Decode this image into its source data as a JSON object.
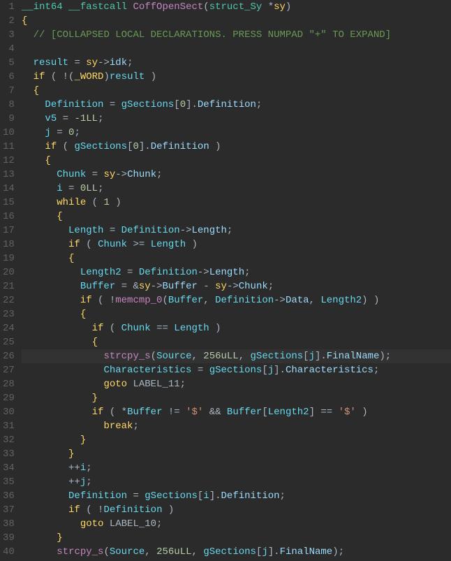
{
  "highlighted_line": 26,
  "lines": [
    {
      "n": 1,
      "tokens": [
        {
          "t": "__int64 __fastcall ",
          "c": "tok-type"
        },
        {
          "t": "CoffOpenSect",
          "c": "tok-func"
        },
        {
          "t": "(",
          "c": "tok-paren"
        },
        {
          "t": "struct_Sy ",
          "c": "tok-type"
        },
        {
          "t": "*",
          "c": "tok-op"
        },
        {
          "t": "sy",
          "c": "tok-id"
        },
        {
          "t": ")",
          "c": "tok-paren"
        }
      ]
    },
    {
      "n": 2,
      "tokens": [
        {
          "t": "{",
          "c": "tok-brace"
        }
      ]
    },
    {
      "n": 3,
      "tokens": [
        {
          "t": "  ",
          "c": ""
        },
        {
          "t": "// [COLLAPSED LOCAL DECLARATIONS. PRESS NUMPAD \"+\" TO EXPAND]",
          "c": "tok-comment"
        }
      ]
    },
    {
      "n": 4,
      "tokens": []
    },
    {
      "n": 5,
      "tokens": [
        {
          "t": "  ",
          "c": ""
        },
        {
          "t": "result",
          "c": "tok-local"
        },
        {
          "t": " = ",
          "c": "tok-op"
        },
        {
          "t": "sy",
          "c": "tok-id"
        },
        {
          "t": "->",
          "c": "tok-op"
        },
        {
          "t": "idk",
          "c": "tok-member"
        },
        {
          "t": ";",
          "c": "tok-punc"
        }
      ]
    },
    {
      "n": 6,
      "tokens": [
        {
          "t": "  ",
          "c": ""
        },
        {
          "t": "if",
          "c": "tok-kw"
        },
        {
          "t": " ( !(",
          "c": "tok-paren"
        },
        {
          "t": "_WORD",
          "c": "tok-cast"
        },
        {
          "t": ")",
          "c": "tok-paren"
        },
        {
          "t": "result",
          "c": "tok-local"
        },
        {
          "t": " )",
          "c": "tok-paren"
        }
      ]
    },
    {
      "n": 7,
      "tokens": [
        {
          "t": "  ",
          "c": ""
        },
        {
          "t": "{",
          "c": "tok-brace"
        }
      ]
    },
    {
      "n": 8,
      "tokens": [
        {
          "t": "    ",
          "c": ""
        },
        {
          "t": "Definition",
          "c": "tok-local"
        },
        {
          "t": " = ",
          "c": "tok-op"
        },
        {
          "t": "gSections",
          "c": "tok-global"
        },
        {
          "t": "[",
          "c": "tok-paren"
        },
        {
          "t": "0",
          "c": "tok-num"
        },
        {
          "t": "].",
          "c": "tok-punc"
        },
        {
          "t": "Definition",
          "c": "tok-member"
        },
        {
          "t": ";",
          "c": "tok-punc"
        }
      ]
    },
    {
      "n": 9,
      "tokens": [
        {
          "t": "    ",
          "c": ""
        },
        {
          "t": "v5",
          "c": "tok-local"
        },
        {
          "t": " = ",
          "c": "tok-op"
        },
        {
          "t": "-1LL",
          "c": "tok-num"
        },
        {
          "t": ";",
          "c": "tok-punc"
        }
      ]
    },
    {
      "n": 10,
      "tokens": [
        {
          "t": "    ",
          "c": ""
        },
        {
          "t": "j",
          "c": "tok-local"
        },
        {
          "t": " = ",
          "c": "tok-op"
        },
        {
          "t": "0",
          "c": "tok-num"
        },
        {
          "t": ";",
          "c": "tok-punc"
        }
      ]
    },
    {
      "n": 11,
      "tokens": [
        {
          "t": "    ",
          "c": ""
        },
        {
          "t": "if",
          "c": "tok-kw"
        },
        {
          "t": " ( ",
          "c": "tok-paren"
        },
        {
          "t": "gSections",
          "c": "tok-global"
        },
        {
          "t": "[",
          "c": "tok-paren"
        },
        {
          "t": "0",
          "c": "tok-num"
        },
        {
          "t": "].",
          "c": "tok-punc"
        },
        {
          "t": "Definition",
          "c": "tok-member"
        },
        {
          "t": " )",
          "c": "tok-paren"
        }
      ]
    },
    {
      "n": 12,
      "tokens": [
        {
          "t": "    ",
          "c": ""
        },
        {
          "t": "{",
          "c": "tok-brace"
        }
      ]
    },
    {
      "n": 13,
      "tokens": [
        {
          "t": "      ",
          "c": ""
        },
        {
          "t": "Chunk",
          "c": "tok-local"
        },
        {
          "t": " = ",
          "c": "tok-op"
        },
        {
          "t": "sy",
          "c": "tok-id"
        },
        {
          "t": "->",
          "c": "tok-op"
        },
        {
          "t": "Chunk",
          "c": "tok-member"
        },
        {
          "t": ";",
          "c": "tok-punc"
        }
      ]
    },
    {
      "n": 14,
      "tokens": [
        {
          "t": "      ",
          "c": ""
        },
        {
          "t": "i",
          "c": "tok-local"
        },
        {
          "t": " = ",
          "c": "tok-op"
        },
        {
          "t": "0LL",
          "c": "tok-num"
        },
        {
          "t": ";",
          "c": "tok-punc"
        }
      ]
    },
    {
      "n": 15,
      "tokens": [
        {
          "t": "      ",
          "c": ""
        },
        {
          "t": "while",
          "c": "tok-kw"
        },
        {
          "t": " ( ",
          "c": "tok-paren"
        },
        {
          "t": "1",
          "c": "tok-num"
        },
        {
          "t": " )",
          "c": "tok-paren"
        }
      ]
    },
    {
      "n": 16,
      "tokens": [
        {
          "t": "      ",
          "c": ""
        },
        {
          "t": "{",
          "c": "tok-brace"
        }
      ]
    },
    {
      "n": 17,
      "tokens": [
        {
          "t": "        ",
          "c": ""
        },
        {
          "t": "Length",
          "c": "tok-local"
        },
        {
          "t": " = ",
          "c": "tok-op"
        },
        {
          "t": "Definition",
          "c": "tok-local"
        },
        {
          "t": "->",
          "c": "tok-op"
        },
        {
          "t": "Length",
          "c": "tok-member"
        },
        {
          "t": ";",
          "c": "tok-punc"
        }
      ]
    },
    {
      "n": 18,
      "tokens": [
        {
          "t": "        ",
          "c": ""
        },
        {
          "t": "if",
          "c": "tok-kw"
        },
        {
          "t": " ( ",
          "c": "tok-paren"
        },
        {
          "t": "Chunk",
          "c": "tok-local"
        },
        {
          "t": " >= ",
          "c": "tok-op"
        },
        {
          "t": "Length",
          "c": "tok-local"
        },
        {
          "t": " )",
          "c": "tok-paren"
        }
      ]
    },
    {
      "n": 19,
      "tokens": [
        {
          "t": "        ",
          "c": ""
        },
        {
          "t": "{",
          "c": "tok-brace"
        }
      ]
    },
    {
      "n": 20,
      "tokens": [
        {
          "t": "          ",
          "c": ""
        },
        {
          "t": "Length2",
          "c": "tok-local"
        },
        {
          "t": " = ",
          "c": "tok-op"
        },
        {
          "t": "Definition",
          "c": "tok-local"
        },
        {
          "t": "->",
          "c": "tok-op"
        },
        {
          "t": "Length",
          "c": "tok-member"
        },
        {
          "t": ";",
          "c": "tok-punc"
        }
      ]
    },
    {
      "n": 21,
      "tokens": [
        {
          "t": "          ",
          "c": ""
        },
        {
          "t": "Buffer",
          "c": "tok-local"
        },
        {
          "t": " = &",
          "c": "tok-op"
        },
        {
          "t": "sy",
          "c": "tok-id"
        },
        {
          "t": "->",
          "c": "tok-op"
        },
        {
          "t": "Buffer",
          "c": "tok-member"
        },
        {
          "t": " - ",
          "c": "tok-op"
        },
        {
          "t": "sy",
          "c": "tok-id"
        },
        {
          "t": "->",
          "c": "tok-op"
        },
        {
          "t": "Chunk",
          "c": "tok-member"
        },
        {
          "t": ";",
          "c": "tok-punc"
        }
      ]
    },
    {
      "n": 22,
      "tokens": [
        {
          "t": "          ",
          "c": ""
        },
        {
          "t": "if",
          "c": "tok-kw"
        },
        {
          "t": " ( !",
          "c": "tok-paren"
        },
        {
          "t": "memcmp_0",
          "c": "tok-func"
        },
        {
          "t": "(",
          "c": "tok-paren"
        },
        {
          "t": "Buffer",
          "c": "tok-local"
        },
        {
          "t": ", ",
          "c": "tok-punc"
        },
        {
          "t": "Definition",
          "c": "tok-local"
        },
        {
          "t": "->",
          "c": "tok-op"
        },
        {
          "t": "Data",
          "c": "tok-member"
        },
        {
          "t": ", ",
          "c": "tok-punc"
        },
        {
          "t": "Length2",
          "c": "tok-local"
        },
        {
          "t": ") )",
          "c": "tok-paren"
        }
      ]
    },
    {
      "n": 23,
      "tokens": [
        {
          "t": "          ",
          "c": ""
        },
        {
          "t": "{",
          "c": "tok-brace"
        }
      ]
    },
    {
      "n": 24,
      "tokens": [
        {
          "t": "            ",
          "c": ""
        },
        {
          "t": "if",
          "c": "tok-kw"
        },
        {
          "t": " ( ",
          "c": "tok-paren"
        },
        {
          "t": "Chunk",
          "c": "tok-local"
        },
        {
          "t": " == ",
          "c": "tok-op"
        },
        {
          "t": "Length",
          "c": "tok-local"
        },
        {
          "t": " )",
          "c": "tok-paren"
        }
      ]
    },
    {
      "n": 25,
      "tokens": [
        {
          "t": "            ",
          "c": ""
        },
        {
          "t": "{",
          "c": "tok-brace"
        }
      ]
    },
    {
      "n": 26,
      "tokens": [
        {
          "t": "              ",
          "c": ""
        },
        {
          "t": "strcpy_s",
          "c": "tok-func"
        },
        {
          "t": "(",
          "c": "tok-paren"
        },
        {
          "t": "Source",
          "c": "tok-local"
        },
        {
          "t": ", ",
          "c": "tok-punc"
        },
        {
          "t": "256uLL",
          "c": "tok-num"
        },
        {
          "t": ", ",
          "c": "tok-punc"
        },
        {
          "t": "gSections",
          "c": "tok-global"
        },
        {
          "t": "[",
          "c": "tok-paren"
        },
        {
          "t": "j",
          "c": "tok-local"
        },
        {
          "t": "].",
          "c": "tok-punc"
        },
        {
          "t": "FinalName",
          "c": "tok-member"
        },
        {
          "t": ");",
          "c": "tok-paren"
        }
      ]
    },
    {
      "n": 27,
      "tokens": [
        {
          "t": "              ",
          "c": ""
        },
        {
          "t": "Characteristics",
          "c": "tok-local"
        },
        {
          "t": " = ",
          "c": "tok-op"
        },
        {
          "t": "gSections",
          "c": "tok-global"
        },
        {
          "t": "[",
          "c": "tok-paren"
        },
        {
          "t": "j",
          "c": "tok-local"
        },
        {
          "t": "].",
          "c": "tok-punc"
        },
        {
          "t": "Characteristics",
          "c": "tok-member"
        },
        {
          "t": ";",
          "c": "tok-punc"
        }
      ]
    },
    {
      "n": 28,
      "tokens": [
        {
          "t": "              ",
          "c": ""
        },
        {
          "t": "goto",
          "c": "tok-kw"
        },
        {
          "t": " LABEL_11;",
          "c": "tok-punc"
        }
      ]
    },
    {
      "n": 29,
      "tokens": [
        {
          "t": "            ",
          "c": ""
        },
        {
          "t": "}",
          "c": "tok-brace"
        }
      ]
    },
    {
      "n": 30,
      "tokens": [
        {
          "t": "            ",
          "c": ""
        },
        {
          "t": "if",
          "c": "tok-kw"
        },
        {
          "t": " ( *",
          "c": "tok-paren"
        },
        {
          "t": "Buffer",
          "c": "tok-local"
        },
        {
          "t": " != ",
          "c": "tok-op"
        },
        {
          "t": "'$'",
          "c": "tok-str"
        },
        {
          "t": " && ",
          "c": "tok-op"
        },
        {
          "t": "Buffer",
          "c": "tok-local"
        },
        {
          "t": "[",
          "c": "tok-paren"
        },
        {
          "t": "Length2",
          "c": "tok-local"
        },
        {
          "t": "] == ",
          "c": "tok-op"
        },
        {
          "t": "'$'",
          "c": "tok-str"
        },
        {
          "t": " )",
          "c": "tok-paren"
        }
      ]
    },
    {
      "n": 31,
      "tokens": [
        {
          "t": "              ",
          "c": ""
        },
        {
          "t": "break",
          "c": "tok-kw"
        },
        {
          "t": ";",
          "c": "tok-punc"
        }
      ]
    },
    {
      "n": 32,
      "tokens": [
        {
          "t": "          ",
          "c": ""
        },
        {
          "t": "}",
          "c": "tok-brace"
        }
      ]
    },
    {
      "n": 33,
      "tokens": [
        {
          "t": "        ",
          "c": ""
        },
        {
          "t": "}",
          "c": "tok-brace"
        }
      ]
    },
    {
      "n": 34,
      "tokens": [
        {
          "t": "        ++",
          "c": "tok-op"
        },
        {
          "t": "i",
          "c": "tok-local"
        },
        {
          "t": ";",
          "c": "tok-punc"
        }
      ]
    },
    {
      "n": 35,
      "tokens": [
        {
          "t": "        ++",
          "c": "tok-op"
        },
        {
          "t": "j",
          "c": "tok-local"
        },
        {
          "t": ";",
          "c": "tok-punc"
        }
      ]
    },
    {
      "n": 36,
      "tokens": [
        {
          "t": "        ",
          "c": ""
        },
        {
          "t": "Definition",
          "c": "tok-local"
        },
        {
          "t": " = ",
          "c": "tok-op"
        },
        {
          "t": "gSections",
          "c": "tok-global"
        },
        {
          "t": "[",
          "c": "tok-paren"
        },
        {
          "t": "i",
          "c": "tok-local"
        },
        {
          "t": "].",
          "c": "tok-punc"
        },
        {
          "t": "Definition",
          "c": "tok-member"
        },
        {
          "t": ";",
          "c": "tok-punc"
        }
      ]
    },
    {
      "n": 37,
      "tokens": [
        {
          "t": "        ",
          "c": ""
        },
        {
          "t": "if",
          "c": "tok-kw"
        },
        {
          "t": " ( !",
          "c": "tok-paren"
        },
        {
          "t": "Definition",
          "c": "tok-local"
        },
        {
          "t": " )",
          "c": "tok-paren"
        }
      ]
    },
    {
      "n": 38,
      "tokens": [
        {
          "t": "          ",
          "c": ""
        },
        {
          "t": "goto",
          "c": "tok-kw"
        },
        {
          "t": " LABEL_10;",
          "c": "tok-punc"
        }
      ]
    },
    {
      "n": 39,
      "tokens": [
        {
          "t": "      ",
          "c": ""
        },
        {
          "t": "}",
          "c": "tok-brace"
        }
      ]
    },
    {
      "n": 40,
      "tokens": [
        {
          "t": "      ",
          "c": ""
        },
        {
          "t": "strcpy_s",
          "c": "tok-func"
        },
        {
          "t": "(",
          "c": "tok-paren"
        },
        {
          "t": "Source",
          "c": "tok-local"
        },
        {
          "t": ", ",
          "c": "tok-punc"
        },
        {
          "t": "256uLL",
          "c": "tok-num"
        },
        {
          "t": ", ",
          "c": "tok-punc"
        },
        {
          "t": "gSections",
          "c": "tok-global"
        },
        {
          "t": "[",
          "c": "tok-paren"
        },
        {
          "t": "j",
          "c": "tok-local"
        },
        {
          "t": "].",
          "c": "tok-punc"
        },
        {
          "t": "FinalName",
          "c": "tok-member"
        },
        {
          "t": ");",
          "c": "tok-paren"
        }
      ]
    }
  ]
}
